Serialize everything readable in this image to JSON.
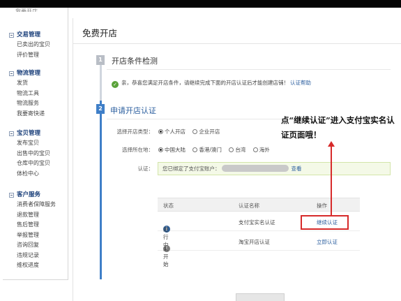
{
  "sidebar": {
    "cut_item": "我要开店",
    "groups": [
      {
        "title": "交易管理",
        "items": [
          "已卖出的宝贝",
          "评价管理"
        ]
      },
      {
        "title": "物流管理",
        "items": [
          "发货",
          "物流工具",
          "物流服务",
          "我要寄快递"
        ]
      },
      {
        "title": "宝贝管理",
        "items": [
          "发布宝贝",
          "出售中的宝贝",
          "仓库中的宝贝",
          "体检中心"
        ]
      },
      {
        "title": "客户服务",
        "items": [
          "消费者保障服务",
          "退款管理",
          "售后管理",
          "举报管理",
          "咨询回复",
          "违规记录",
          "维权进度"
        ]
      }
    ]
  },
  "main": {
    "title": "免费开店",
    "step1": {
      "number": "1",
      "title": "开店条件检测",
      "notice": "亲，恭喜您满足开店条件，请继续完成下面的开店认证后才能创建店铺！",
      "notice_link": "认证帮助"
    },
    "step2": {
      "number": "2",
      "title": "申请开店认证",
      "type_label": "选择开店类型：",
      "type_options": [
        "个人开店",
        "企业开店"
      ],
      "location_label": "选择所在地：",
      "location_options": [
        "中国大陆",
        "香港/澳门",
        "台湾",
        "海外"
      ],
      "auth_label": "认证：",
      "auth_text": "您已绑定了支付宝账户：",
      "auth_link": "查看"
    },
    "table": {
      "headers": [
        "状态",
        "认证名称",
        "操作"
      ],
      "rows": [
        {
          "status": "进行中",
          "icon": "i",
          "name": "支付宝实名认证",
          "action": "继续认证"
        },
        {
          "status": "未开始",
          "icon": "!",
          "name": "淘宝开店认证",
          "action": "立即认证"
        }
      ]
    }
  },
  "annotation": {
    "text": "点“继续认证”进入支付宝实名认证页面哦！",
    "color": "#d72a2a"
  },
  "colors": {
    "accent": "#3f7fc8",
    "link": "#2c5f9f",
    "success": "#5aa23a"
  }
}
